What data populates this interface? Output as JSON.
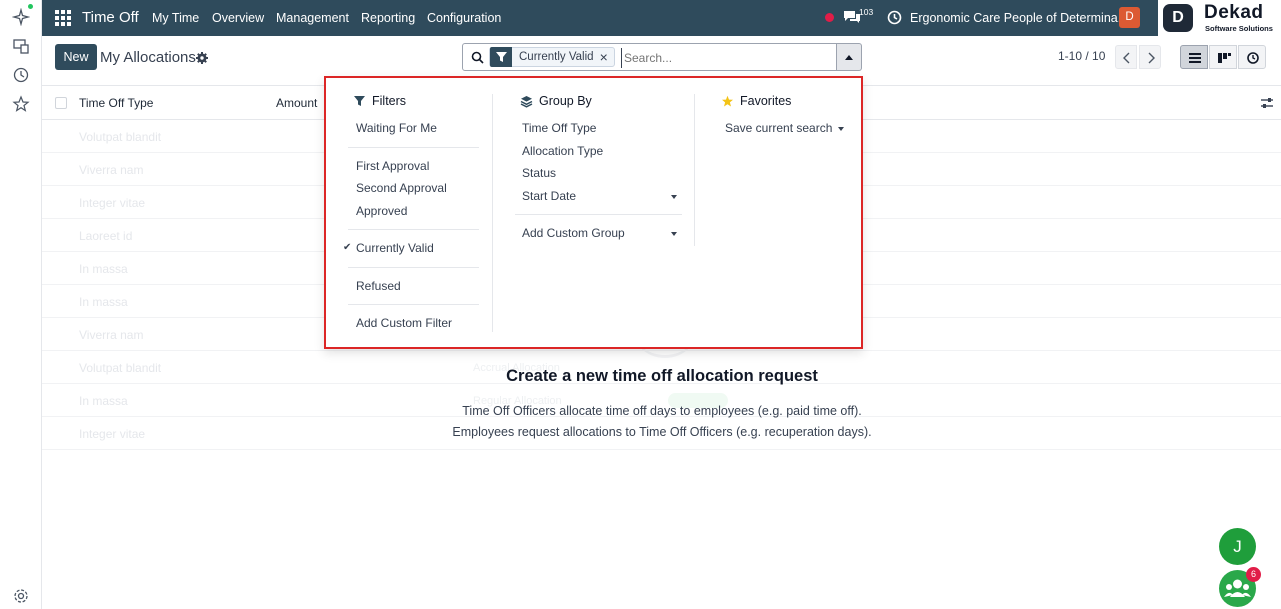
{
  "navbar": {
    "app_name": "Time Off",
    "menu": [
      "My Time",
      "Overview",
      "Management",
      "Reporting",
      "Configuration"
    ],
    "chat_count": "103",
    "company": "Ergonomic Care People of Determina...",
    "avatar_letter": "D"
  },
  "logo": {
    "name": "Dekad",
    "tagline": "Software Solutions"
  },
  "control_panel": {
    "new_label": "New",
    "title": "My Allocations",
    "search": {
      "facet": "Currently Valid",
      "placeholder": "Search..."
    },
    "pager": "1-10 / 10"
  },
  "list": {
    "columns": [
      "Time Off Type",
      "Amount"
    ],
    "faded_rows": [
      "Volutpat blandit",
      "Viverra nam",
      "Integer vitae",
      "Laoreet id",
      "In massa",
      "In massa",
      "Viverra nam",
      "Volutpat blandit",
      "In massa",
      "Integer vitae"
    ]
  },
  "background_hint": {
    "line1": "Accrual Allocation",
    "line2": "Regular Allocation"
  },
  "empty_state": {
    "title": "Create a new time off allocation request",
    "line1": "Time Off Officers allocate time off days to employees (e.g. paid time off).",
    "line2": "Employees request allocations to Time Off Officers (e.g. recuperation days)."
  },
  "dropdown": {
    "filters": {
      "title": "Filters",
      "groups": [
        [
          "Waiting For Me"
        ],
        [
          "First Approval",
          "Second Approval",
          "Approved"
        ],
        [
          "Currently Valid"
        ],
        [
          "Refused"
        ],
        [
          "Add Custom Filter"
        ]
      ],
      "checked": "Currently Valid"
    },
    "group_by": {
      "title": "Group By",
      "items": [
        "Time Off Type",
        "Allocation Type",
        "Status",
        "Start Date"
      ],
      "custom": "Add Custom Group"
    },
    "favorites": {
      "title": "Favorites",
      "save": "Save current search"
    }
  },
  "floating": {
    "user_initial": "J",
    "notify_count": "6"
  },
  "colors": {
    "navbar": "#2f4b5c",
    "highlight_border": "#dc2626",
    "fab": "#1f9e3b"
  }
}
